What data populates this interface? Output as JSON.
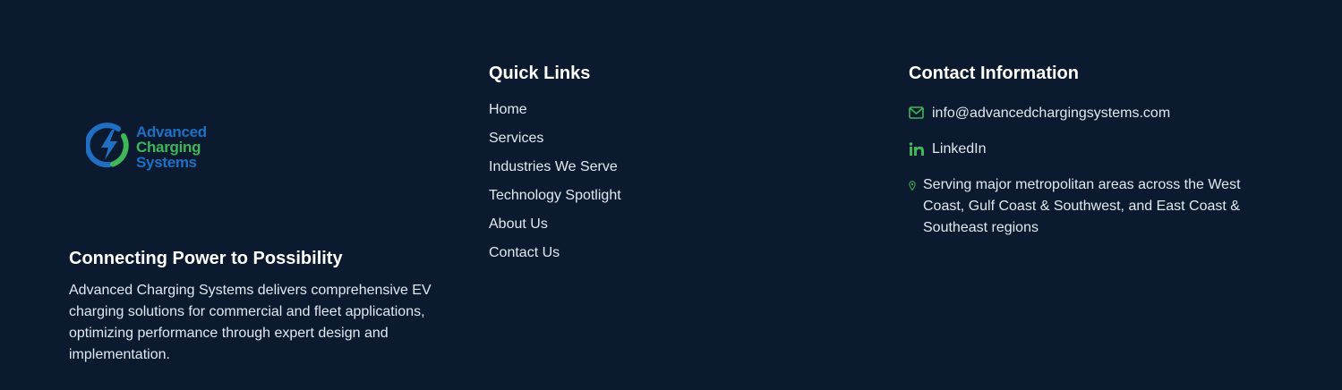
{
  "brand": {
    "logo_lines": [
      "Advanced",
      "Charging",
      "Systems"
    ],
    "tagline": "Connecting Power to Possibility",
    "description": "Advanced Charging Systems delivers comprehensive EV charging solutions for commercial and fleet applications, optimizing performance through expert design and implementation."
  },
  "quick_links": {
    "heading": "Quick Links",
    "items": [
      {
        "label": "Home"
      },
      {
        "label": "Services"
      },
      {
        "label": "Industries We Serve"
      },
      {
        "label": "Technology Spotlight"
      },
      {
        "label": "About Us"
      },
      {
        "label": "Contact Us"
      }
    ]
  },
  "contact": {
    "heading": "Contact Information",
    "email": {
      "icon": "mail-icon",
      "text": "info@advancedchargingsystems.com"
    },
    "linkedin": {
      "icon": "linkedin-icon",
      "text": "LinkedIn"
    },
    "location": {
      "icon": "map-pin-icon",
      "text": "Serving major metropolitan areas across the West Coast, Gulf Coast & Southwest, and East Coast & Southeast regions"
    }
  },
  "colors": {
    "background": "#0b1a2e",
    "brand_blue": "#1f6fc4",
    "brand_green": "#3fb65a",
    "icon_accent": "#3fb65a"
  }
}
